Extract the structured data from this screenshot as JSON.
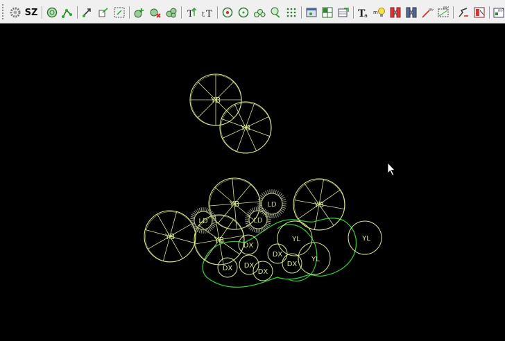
{
  "toolbar": {
    "text_button": "SZ",
    "items": [
      {
        "name": "settings-icon"
      },
      {
        "name": "sz-button",
        "label": "SZ"
      },
      {
        "name": "circle-refresh-icon"
      },
      {
        "name": "polyline-node-icon"
      },
      {
        "name": "arrow-edit-icon"
      },
      {
        "name": "copy-arrow-icon"
      },
      {
        "name": "select-box-icon"
      },
      {
        "name": "tree-add-icon"
      },
      {
        "name": "tree-delete-icon"
      },
      {
        "name": "tree-cluster-icon"
      },
      {
        "name": "text-up-icon"
      },
      {
        "name": "text-tt-icon"
      },
      {
        "name": "circle-target-icon"
      },
      {
        "name": "circle-dot-icon"
      },
      {
        "name": "shrub-group-icon"
      },
      {
        "name": "shrub-arrow-icon"
      },
      {
        "name": "dot-grid-icon"
      },
      {
        "name": "window-icon"
      },
      {
        "name": "excel-grid-icon"
      },
      {
        "name": "export-table-icon"
      },
      {
        "name": "text-style-icon"
      },
      {
        "name": "lightbulb-icon"
      },
      {
        "name": "red-block-icon"
      },
      {
        "name": "blue-block-icon"
      },
      {
        "name": "area-line-icon"
      },
      {
        "name": "area-box-icon"
      },
      {
        "name": "route-icon"
      },
      {
        "name": "red-window-icon"
      },
      {
        "name": "legend-icon"
      }
    ]
  },
  "drawing": {
    "colors": {
      "tree": "#d8eb8a",
      "ld": "#c8d87c",
      "ld_fringe": "#9a9a8a",
      "shrub_outline": "#2ecc2e",
      "small": "#d8eb8a",
      "background": "#000000"
    },
    "labels": {
      "yb": "YB",
      "ld": "LD",
      "dx": "DX",
      "yl": "YL"
    }
  }
}
